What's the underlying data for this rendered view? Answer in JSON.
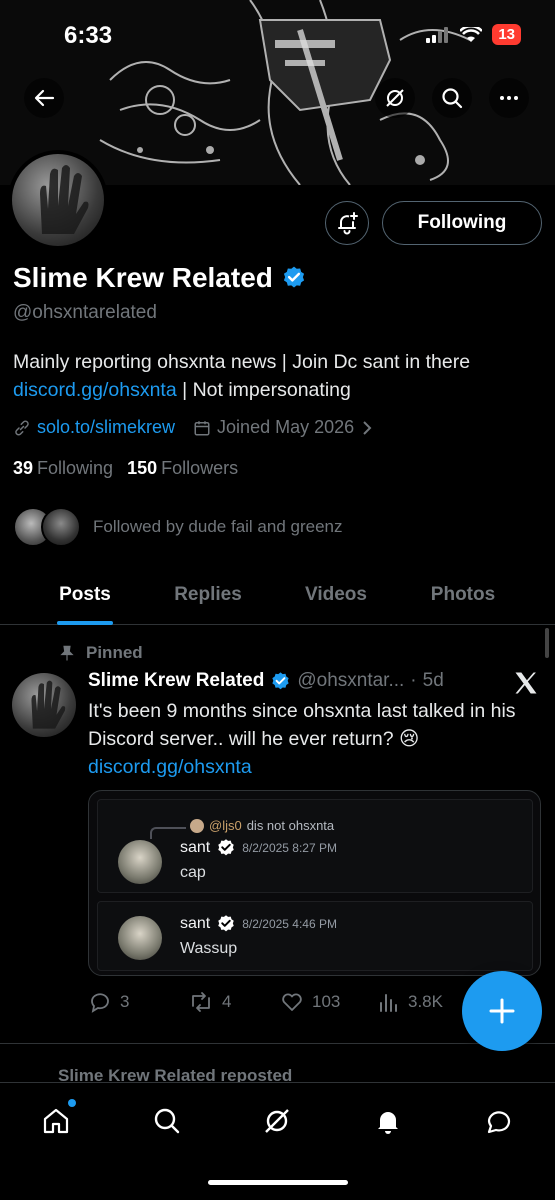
{
  "status_bar": {
    "time": "6:33",
    "battery": "13"
  },
  "profile": {
    "name": "Slime Krew Related",
    "handle": "@ohsxntarelated",
    "bio_text": "Mainly reporting ohsxnta news | Join Dc sant in there",
    "bio_link": "discord.gg/ohsxnta",
    "bio_suffix": " | Not impersonating",
    "website": "solo.to/slimekrew",
    "joined": "Joined May 2026",
    "following_count": "39",
    "following_label": "Following",
    "followers_count": "150",
    "followers_label": "Followers",
    "followed_by": "Followed by dude fail and greenz",
    "follow_button": "Following"
  },
  "tabs": [
    "Posts",
    "Replies",
    "Videos",
    "Photos"
  ],
  "post": {
    "pinned_label": "Pinned",
    "author": "Slime Krew Related",
    "handle": "@ohsxntar...",
    "separator": "·",
    "age": "5d",
    "text": "It's been 9 months since ohsxnta last talked in his Discord server.. will he ever return? 😢",
    "link": "discord.gg/ohsxnta",
    "embed": {
      "reply_user": "@ljs0",
      "reply_text": "dis not ohsxnta",
      "messages": [
        {
          "user": "sant",
          "time": "8/2/2025 8:27 PM",
          "text": "cap"
        },
        {
          "user": "sant",
          "time": "8/2/2025 4:46 PM",
          "text": "Wassup"
        }
      ]
    },
    "stats": {
      "replies": "3",
      "reposts": "4",
      "likes": "103",
      "views": "3.8K"
    }
  },
  "next_post_peek": "Slime Krew Related reposted",
  "colors": {
    "accent": "#1d9bf0",
    "background": "#000000",
    "muted": "#71767b"
  }
}
